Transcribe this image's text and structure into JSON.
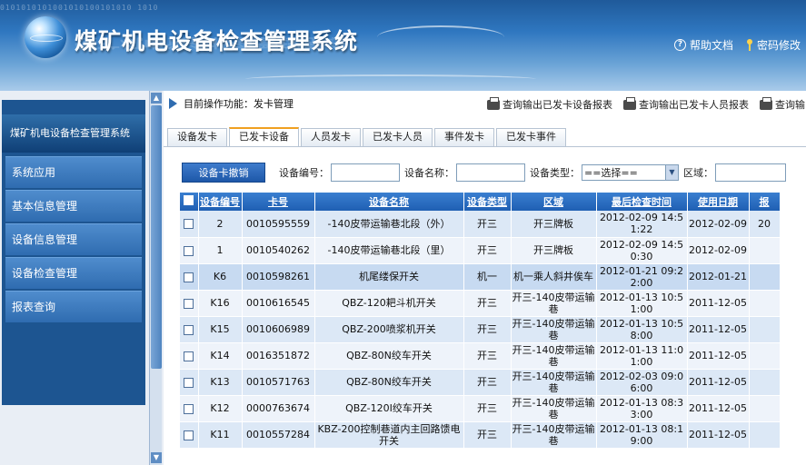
{
  "header": {
    "binary_strip": "0101010101001010100101010 1010",
    "title": "煤矿机电设备检查管理系统",
    "links": [
      {
        "icon": "help-icon",
        "label": "帮助文档"
      },
      {
        "icon": "key-icon",
        "label": "密码修改"
      }
    ]
  },
  "sidebar": {
    "title": "煤矿机电设备检查管理系统",
    "items": [
      {
        "label": "系统应用"
      },
      {
        "label": "基本信息管理"
      },
      {
        "label": "设备信息管理"
      },
      {
        "label": "设备检查管理"
      },
      {
        "label": "报表查询"
      }
    ]
  },
  "topbar": {
    "current_op": "目前操作功能：发卡管理",
    "reports": [
      {
        "icon": "printer-icon",
        "label": "查询输出已发卡设备报表"
      },
      {
        "icon": "printer-icon",
        "label": "查询输出已发卡人员报表"
      },
      {
        "icon": "printer-icon",
        "label": "查询输"
      }
    ]
  },
  "tabs": [
    {
      "label": "设备发卡",
      "active": false
    },
    {
      "label": "已发卡设备",
      "active": true
    },
    {
      "label": "人员发卡",
      "active": false
    },
    {
      "label": "已发卡人员",
      "active": false
    },
    {
      "label": "事件发卡",
      "active": false
    },
    {
      "label": "已发卡事件",
      "active": false
    }
  ],
  "filters": {
    "revoke_button": "设备卡撤销",
    "device_no_label": "设备编号：",
    "device_no_value": "",
    "device_name_label": "设备名称：",
    "device_name_value": "",
    "device_type_label": "设备类型：",
    "device_type_value": "==选择==",
    "area_label": "区域：",
    "area_value": ""
  },
  "table": {
    "columns": [
      "设备编号",
      "卡号",
      "设备名称",
      "设备类型",
      "区域",
      "最后检查时间",
      "使用日期",
      "报"
    ],
    "rows": [
      [
        "2",
        "0010595559",
        "-140皮带运输巷北段（外）",
        "开三",
        "开三牌板",
        "2012-02-09 14:51:22",
        "2012-02-09",
        "20"
      ],
      [
        "1",
        "0010540262",
        "-140皮带运输巷北段（里）",
        "开三",
        "开三牌板",
        "2012-02-09 14:50:30",
        "2012-02-09",
        ""
      ],
      [
        "K6",
        "0010598261",
        "机尾缕保开关",
        "机一",
        "机一乘人斜井俟车",
        "2012-01-21 09:22:00",
        "2012-01-21",
        ""
      ],
      [
        "K16",
        "0010616545",
        "QBZ-120耙斗机开关",
        "开三",
        "开三-140皮带运输巷",
        "2012-01-13 10:51:00",
        "2011-12-05",
        ""
      ],
      [
        "K15",
        "0010606989",
        "QBZ-200喷浆机开关",
        "开三",
        "开三-140皮带运输巷",
        "2012-01-13 10:58:00",
        "2011-12-05",
        ""
      ],
      [
        "K14",
        "0016351872",
        "QBZ-80N绞车开关",
        "开三",
        "开三-140皮带运输巷",
        "2012-01-13 11:01:00",
        "2011-12-05",
        ""
      ],
      [
        "K13",
        "0010571763",
        "QBZ-80N绞车开关",
        "开三",
        "开三-140皮带运输巷",
        "2012-02-03 09:06:00",
        "2011-12-05",
        ""
      ],
      [
        "K12",
        "0000763674",
        "QBZ-120I绞车开关",
        "开三",
        "开三-140皮带运输巷",
        "2012-01-13 08:33:00",
        "2011-12-05",
        ""
      ],
      [
        "K11",
        "0010557284",
        "KBZ-200控制巷道内主回路馈电开关",
        "开三",
        "开三-140皮带运输巷",
        "2012-01-13 08:19:00",
        "2011-12-05",
        ""
      ]
    ]
  }
}
